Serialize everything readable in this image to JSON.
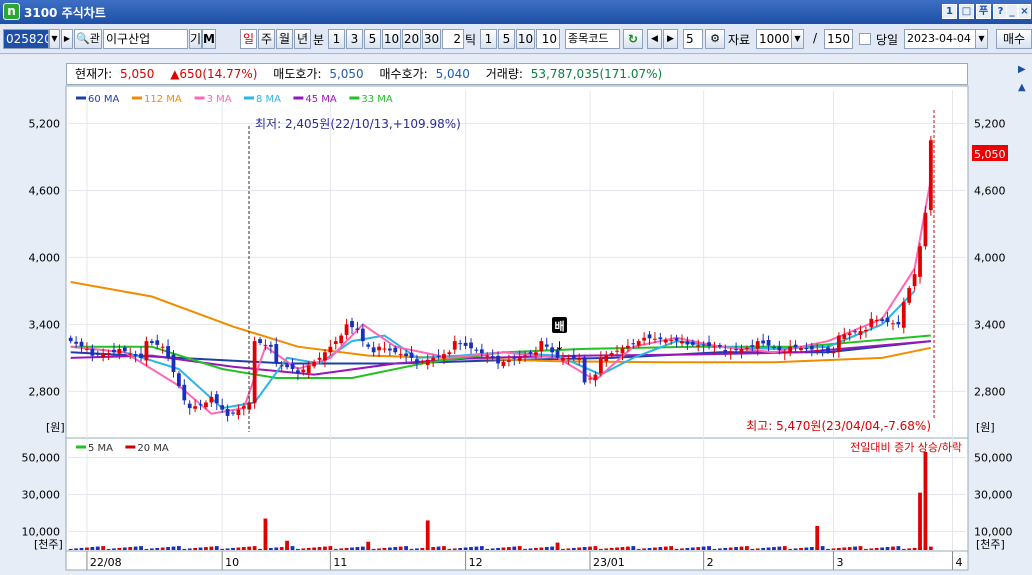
{
  "window": {
    "title": "3100 주식차트",
    "logo": "n",
    "controls": [
      "1",
      "□",
      "푸",
      "?",
      "_",
      "□",
      "×"
    ]
  },
  "toolbar": {
    "code": "025820",
    "lookup_icon": "🔍",
    "lookup_label": "관",
    "name": "이구산업",
    "gi_label": "기",
    "m_label": "M",
    "periods": [
      "일",
      "주",
      "월",
      "년"
    ],
    "active_period": "일",
    "minute_label": "분",
    "minute_options": [
      "1",
      "3",
      "5",
      "10",
      "20",
      "30"
    ],
    "minute_custom": "2",
    "tick_label": "틱",
    "tick_options": [
      "1",
      "5",
      "10"
    ],
    "tick_custom": "10",
    "jongmok_label": "종목코드",
    "refresh_icon": "↻",
    "step_value": "5",
    "data_label": "자료",
    "data_count": "1000",
    "separator": "/",
    "view_count": "150",
    "today_label": "당일",
    "date": "2023-04-04",
    "sell_label": "매수"
  },
  "info": {
    "cur_label": "현재가:",
    "cur_value": "5,050",
    "change": "▲650(14.77%)",
    "ask_label": "매도호가:",
    "ask_value": "5,050",
    "bid_label": "매수호가:",
    "bid_value": "5,040",
    "vol_label": "거래량:",
    "vol_value": "53,787,035(171.07%)"
  },
  "price_legend": [
    {
      "label": "60 MA",
      "color": "#1f3fa8"
    },
    {
      "label": "112 MA",
      "color": "#f08c00"
    },
    {
      "label": "3 MA",
      "color": "#ff66b3"
    },
    {
      "label": "8 MA",
      "color": "#29b5e8"
    },
    {
      "label": "45 MA",
      "color": "#9b16b8"
    },
    {
      "label": "33 MA",
      "color": "#22c222"
    }
  ],
  "volume_legend": [
    {
      "label": "5 MA",
      "color": "#22c222"
    },
    {
      "label": "20 MA",
      "color": "#d00000"
    }
  ],
  "annotations": {
    "low": "최저: 2,405원(22/10/13,+109.98%)",
    "high": "최고: 5,470원(23/04/04,-7.68%)",
    "vol_note": "전일대비 증가 상승/하락",
    "marker": "배",
    "cur_price_tag": "5,050"
  },
  "axis": {
    "unit_price": "[원]",
    "unit_volume": "[천주]"
  },
  "chart_data": {
    "type": "candlestick",
    "price_ticks": [
      2800,
      3400,
      4000,
      4600,
      5200
    ],
    "price_tick_labels": [
      "2,800",
      "3,400",
      "4,000",
      "4,600",
      "5,200"
    ],
    "price_range": [
      2400,
      5500
    ],
    "volume_ticks": [
      10000,
      30000,
      50000
    ],
    "volume_tick_labels": [
      "10,000",
      "30,000",
      "50,000"
    ],
    "volume_range": [
      0,
      53000
    ],
    "x_labels": [
      "22/08",
      "10",
      "11",
      "12",
      "23/01",
      "2",
      "3",
      "4"
    ],
    "x_label_positions": [
      3,
      28,
      48,
      73,
      96,
      117,
      141,
      163
    ],
    "n": 166,
    "segments": [
      [
        0,
        3250,
        3,
        3180
      ],
      [
        4,
        3120,
        8,
        3150
      ],
      [
        9,
        3180,
        13,
        3100
      ],
      [
        14,
        3250,
        17,
        3200
      ],
      [
        18,
        3100,
        21,
        2720
      ],
      [
        22,
        2650,
        25,
        2700
      ],
      [
        26,
        2750,
        29,
        2580
      ],
      [
        30,
        2600,
        33,
        2700
      ],
      [
        34,
        3250,
        37,
        3200
      ],
      [
        38,
        3050,
        41,
        3000
      ],
      [
        42,
        2960,
        46,
        3100
      ],
      [
        47,
        3150,
        50,
        3300
      ],
      [
        51,
        3400,
        53,
        3350
      ],
      [
        54,
        3250,
        56,
        3150
      ],
      [
        57,
        3200,
        63,
        3100
      ],
      [
        64,
        3050,
        70,
        3150
      ],
      [
        71,
        3250,
        78,
        3100
      ],
      [
        79,
        3050,
        86,
        3150
      ],
      [
        87,
        3250,
        90,
        3100
      ],
      [
        91,
        3100,
        94,
        3100
      ],
      [
        95,
        2880,
        97,
        2950
      ],
      [
        98,
        3100,
        105,
        3250
      ],
      [
        106,
        3280,
        113,
        3250
      ],
      [
        114,
        3220,
        120,
        3200
      ],
      [
        121,
        3150,
        126,
        3200
      ],
      [
        127,
        3250,
        132,
        3150
      ],
      [
        133,
        3200,
        141,
        3150
      ],
      [
        142,
        3300,
        147,
        3350
      ],
      [
        148,
        3450,
        153,
        3400
      ],
      [
        154,
        3600,
        156,
        3850
      ],
      [
        157,
        4100,
        158,
        4400
      ],
      [
        159,
        5050,
        159,
        5050
      ]
    ],
    "volume_spikes": [
      {
        "i": 36,
        "v": 17000
      },
      {
        "i": 40,
        "v": 5000
      },
      {
        "i": 55,
        "v": 4500
      },
      {
        "i": 66,
        "v": 16000
      },
      {
        "i": 90,
        "v": 4000
      },
      {
        "i": 138,
        "v": 13000
      },
      {
        "i": 157,
        "v": 31000
      },
      {
        "i": 158,
        "v": 53000
      }
    ],
    "ma_lines": [
      {
        "name": "60 MA",
        "color": "#1f3fa8",
        "points": [
          [
            0,
            3150
          ],
          [
            20,
            3100
          ],
          [
            40,
            3050
          ],
          [
            60,
            3050
          ],
          [
            80,
            3080
          ],
          [
            100,
            3100
          ],
          [
            120,
            3150
          ],
          [
            140,
            3150
          ],
          [
            159,
            3250
          ]
        ]
      },
      {
        "name": "112 MA",
        "color": "#f08c00",
        "points": [
          [
            0,
            3780
          ],
          [
            15,
            3650
          ],
          [
            30,
            3380
          ],
          [
            42,
            3200
          ],
          [
            55,
            3120
          ],
          [
            70,
            3100
          ],
          [
            90,
            3070
          ],
          [
            110,
            3060
          ],
          [
            130,
            3060
          ],
          [
            150,
            3100
          ],
          [
            159,
            3190
          ]
        ]
      },
      {
        "name": "45 MA",
        "color": "#9b16b8",
        "points": [
          [
            0,
            3100
          ],
          [
            15,
            3120
          ],
          [
            30,
            3020
          ],
          [
            45,
            2950
          ],
          [
            60,
            3050
          ],
          [
            75,
            3100
          ],
          [
            95,
            3120
          ],
          [
            115,
            3130
          ],
          [
            135,
            3150
          ],
          [
            159,
            3250
          ]
        ]
      },
      {
        "name": "33 MA",
        "color": "#22c222",
        "points": [
          [
            0,
            3200
          ],
          [
            15,
            3200
          ],
          [
            28,
            3000
          ],
          [
            38,
            2920
          ],
          [
            52,
            2920
          ],
          [
            65,
            3050
          ],
          [
            80,
            3150
          ],
          [
            95,
            3180
          ],
          [
            115,
            3200
          ],
          [
            135,
            3200
          ],
          [
            159,
            3300
          ]
        ]
      },
      {
        "name": "8 MA",
        "color": "#29b5e8",
        "points": [
          [
            0,
            3200
          ],
          [
            10,
            3150
          ],
          [
            20,
            3000
          ],
          [
            28,
            2650
          ],
          [
            34,
            2700
          ],
          [
            40,
            3100
          ],
          [
            46,
            3050
          ],
          [
            52,
            3250
          ],
          [
            58,
            3300
          ],
          [
            64,
            3100
          ],
          [
            72,
            3120
          ],
          [
            80,
            3150
          ],
          [
            90,
            3120
          ],
          [
            98,
            2950
          ],
          [
            104,
            3100
          ],
          [
            112,
            3250
          ],
          [
            120,
            3200
          ],
          [
            130,
            3180
          ],
          [
            140,
            3200
          ],
          [
            150,
            3400
          ],
          [
            156,
            3700
          ]
        ]
      },
      {
        "name": "3 MA",
        "color": "#ff66b3",
        "points": [
          [
            0,
            3200
          ],
          [
            10,
            3150
          ],
          [
            20,
            2850
          ],
          [
            26,
            2600
          ],
          [
            32,
            2650
          ],
          [
            36,
            3200
          ],
          [
            42,
            3000
          ],
          [
            48,
            3100
          ],
          [
            54,
            3400
          ],
          [
            60,
            3200
          ],
          [
            70,
            3100
          ],
          [
            80,
            3150
          ],
          [
            90,
            3100
          ],
          [
            97,
            2900
          ],
          [
            104,
            3200
          ],
          [
            112,
            3280
          ],
          [
            120,
            3200
          ],
          [
            130,
            3150
          ],
          [
            140,
            3250
          ],
          [
            150,
            3450
          ],
          [
            156,
            3900
          ],
          [
            159,
            4700
          ]
        ]
      }
    ]
  }
}
